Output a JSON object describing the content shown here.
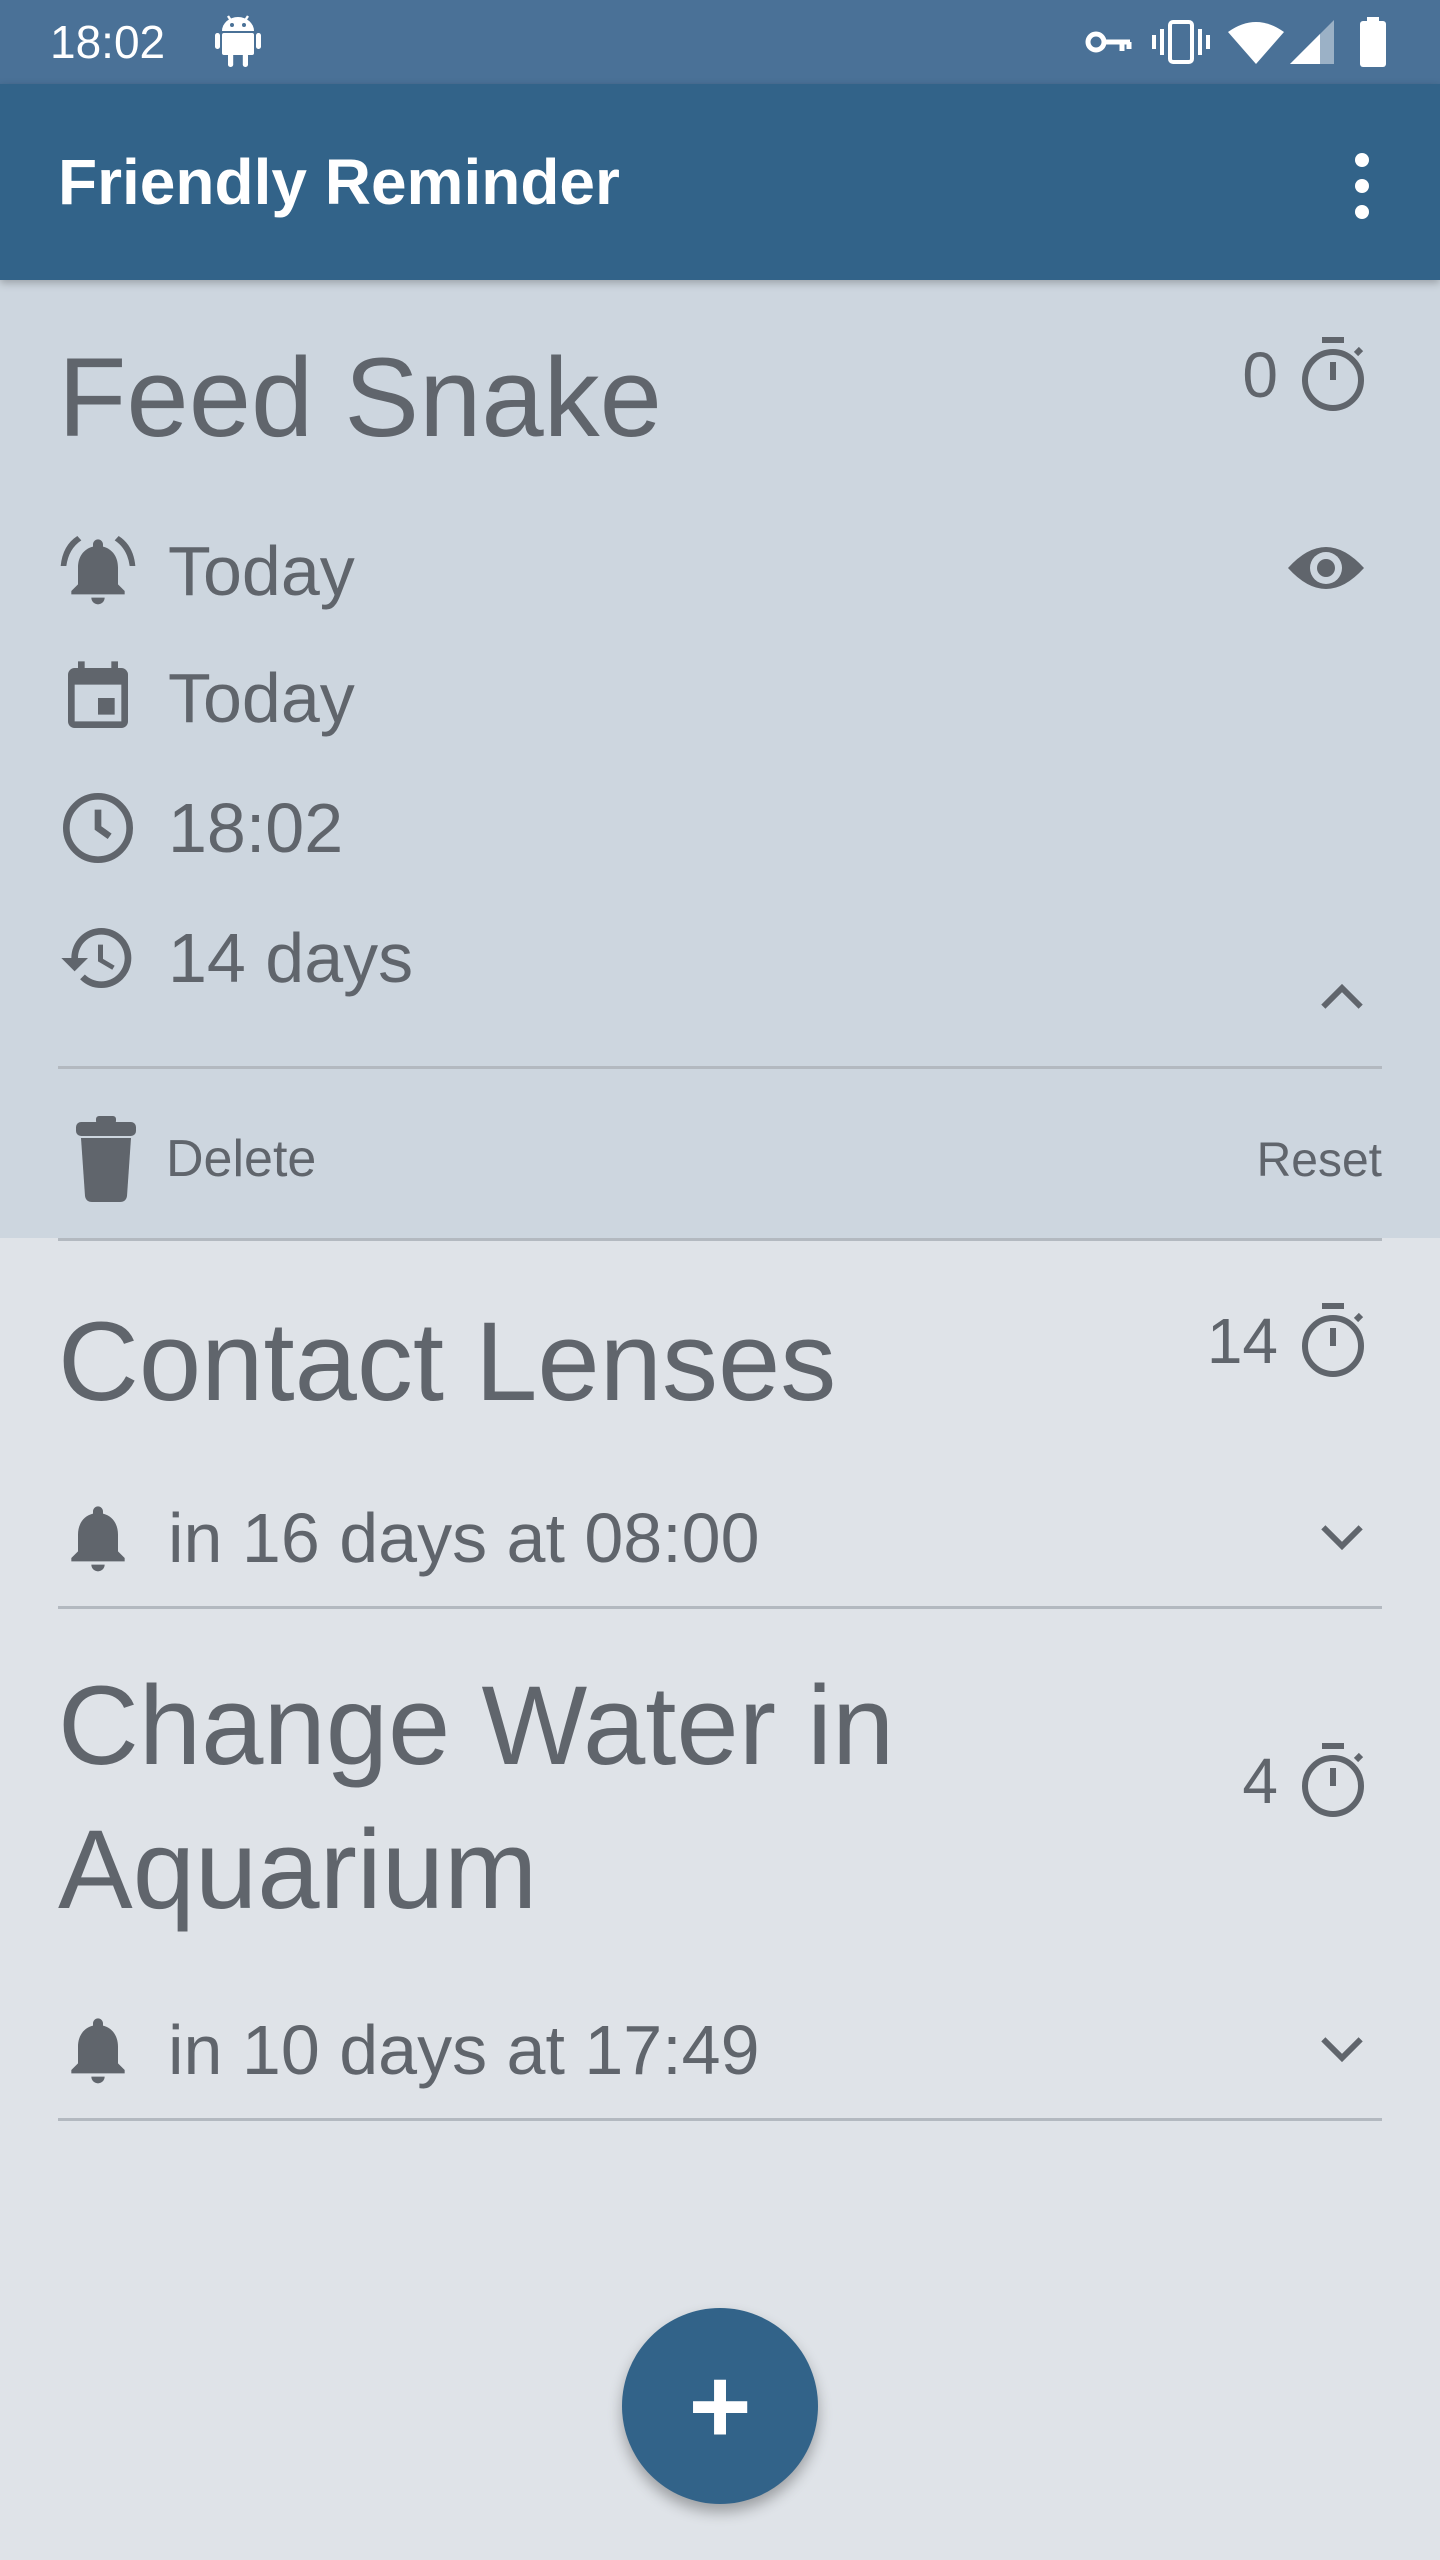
{
  "status_bar": {
    "time": "18:02",
    "icons": [
      "android-icon",
      "key-icon",
      "vibrate-icon",
      "wifi-icon",
      "cellular-signal-icon",
      "battery-icon"
    ]
  },
  "app_bar": {
    "title": "Friendly Reminder",
    "menu_icon": "more-vert-icon"
  },
  "reminders": [
    {
      "title": "Feed Snake",
      "counter": "0",
      "expanded": true,
      "details": {
        "notification": "Today",
        "date": "Today",
        "time": "18:02",
        "interval": "14 days"
      },
      "actions": {
        "delete": "Delete",
        "reset": "Reset"
      }
    },
    {
      "title": "Contact Lenses",
      "counter": "14",
      "expanded": false,
      "next": "in 16 days at 08:00"
    },
    {
      "title_lines": [
        "Change Water in",
        "Aquarium"
      ],
      "counter": "4",
      "expanded": false,
      "next": "in 10 days at 17:49"
    }
  ],
  "fab": {
    "label": "+"
  },
  "colors": {
    "primary": "#326389",
    "status_bar": "#4a7197",
    "background": "#dfe3e8",
    "expanded_card": "#cdd6df",
    "text": "#60656c"
  }
}
